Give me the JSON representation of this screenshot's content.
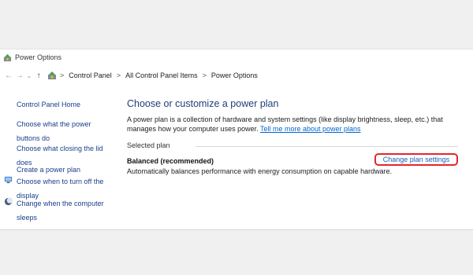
{
  "window": {
    "title": "Power Options",
    "icon": "power-options-icon"
  },
  "address": {
    "back": "←",
    "forward": "→",
    "dropdown": "⌄",
    "up": "↑",
    "crumbs": [
      "Control Panel",
      "All Control Panel Items",
      "Power Options"
    ],
    "separator": ">"
  },
  "sidebar": {
    "items": [
      {
        "label": "Control Panel Home",
        "icon": null
      },
      {
        "label": "Choose what the power buttons do",
        "icon": null
      },
      {
        "label": "Choose what closing the lid does",
        "icon": null
      },
      {
        "label": "Create a power plan",
        "icon": null
      },
      {
        "label": "Choose when to turn off the display",
        "icon": "display-icon"
      },
      {
        "label": "Change when the computer sleeps",
        "icon": "moon-icon"
      }
    ]
  },
  "main": {
    "heading": "Choose or customize a power plan",
    "description": "A power plan is a collection of hardware and system settings (like display brightness, sleep, etc.) that manages how your computer uses power.",
    "link": "Tell me more about power plans",
    "selected_plan_label": "Selected plan",
    "plan_name": "Balanced (recommended)",
    "plan_description": "Automatically balances performance with energy consumption on capable hardware.",
    "change_link": "Change plan settings"
  },
  "colors": {
    "heading": "#1e3f7a",
    "link": "#0066cc",
    "highlight": "#e3262c"
  }
}
